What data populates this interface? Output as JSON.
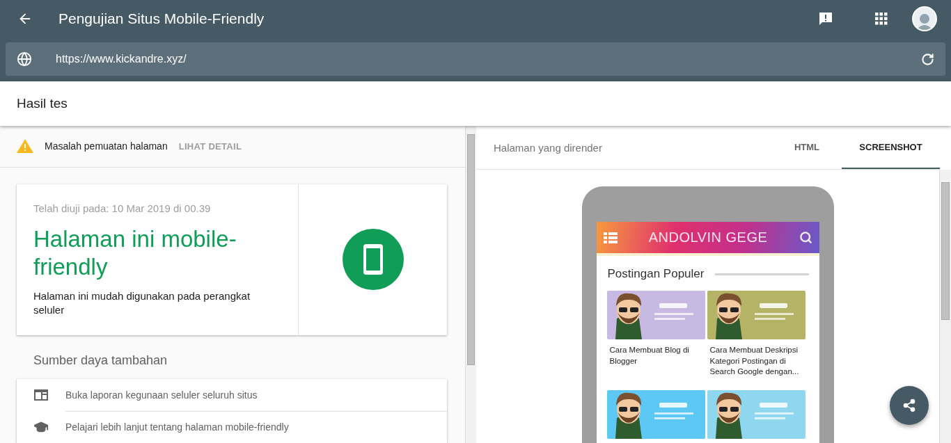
{
  "app_bar": {
    "title": "Pengujian Situs Mobile-Friendly"
  },
  "url_bar": {
    "value": "https://www.kickandre.xyz/"
  },
  "results_header": {
    "title": "Hasil tes"
  },
  "warning": {
    "message": "Masalah pemuatan halaman",
    "action": "LIHAT DETAIL"
  },
  "result_card": {
    "tested_at": "Telah diuji pada: 10 Mar 2019 di 00.39",
    "verdict": "Halaman ini mobile-friendly",
    "description": "Halaman ini mudah digunakan pada perangkat seluler"
  },
  "resources": {
    "title": "Sumber daya tambahan",
    "items": [
      {
        "kind": "report",
        "label": "Buka laporan kegunaan seluler seluruh situs"
      },
      {
        "kind": "learn",
        "label": "Pelajari lebih lanjut tentang halaman mobile-friendly"
      }
    ]
  },
  "rendered_panel": {
    "title": "Halaman yang dirender",
    "tabs": [
      {
        "label": "HTML",
        "selected": false
      },
      {
        "label": "SCREENSHOT",
        "selected": true
      }
    ]
  },
  "mobile_preview": {
    "site_title": "ANDOLVIN GEGE",
    "section_title": "Postingan Populer",
    "posts": [
      {
        "kind": "picture",
        "title": "Cara Membuat Blog di Blogger"
      },
      {
        "kind": "picture",
        "title": "Cara Membuat Deskripsi Kategori Postingan di Search Google dengan..."
      },
      {
        "kind": "picture"
      },
      {
        "kind": "picture"
      }
    ]
  }
}
